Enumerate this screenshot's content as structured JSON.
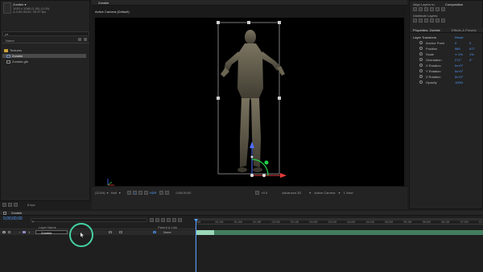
{
  "project": {
    "comp_name": "Zombie ▾",
    "comp_info_1": "1920 x 1080 (1.00) (1.00)",
    "comp_info_2": "Δ 0;00;30;00, 29.97 fps",
    "search_placeholder": "ρ▾",
    "column_name": "Name",
    "items": [
      {
        "label": "Textures",
        "type": "folder"
      },
      {
        "label": "Zombie",
        "type": "comp"
      },
      {
        "label": "Zombie.glb",
        "type": "file"
      }
    ],
    "footer_label": "8 bpc"
  },
  "viewer": {
    "tab_label": "Zombie",
    "camera_label": "Active Camera (Default)",
    "zoom": "(113%)",
    "resolution": "Half",
    "timecode": "0;00;00;00",
    "offset": "+0.0",
    "renderer": "Advanced 3D",
    "camera": "Active Camera",
    "view": "1 View"
  },
  "properties": {
    "align_label": "Align Layers to:",
    "align_value": "Composition",
    "distribute_label": "Distribute Layers:",
    "tab_properties": "Properties: Zombie",
    "tab_effects": "Effects & Presets",
    "section_title": "Layer Transform",
    "reset": "Reset",
    "rows": [
      {
        "name": "Anchor Point",
        "v1": "0",
        "v2": "0"
      },
      {
        "name": "Position",
        "v1": "960",
        "v2": "677"
      },
      {
        "name": "Scale",
        "v1": "∞ 1%",
        "v2": "1%"
      },
      {
        "name": "Orientation",
        "v1": "271°",
        "v2": "0°"
      },
      {
        "name": "X Rotation",
        "v1": "0x+0°",
        "v2": ""
      },
      {
        "name": "Y Rotation",
        "v1": "0x+0°",
        "v2": ""
      },
      {
        "name": "Z Rotation",
        "v1": "0x+0°",
        "v2": ""
      },
      {
        "name": "Opacity",
        "v1": "100%",
        "v2": ""
      }
    ]
  },
  "timeline": {
    "tab_label": "Zombie",
    "timecode": "0;00;00;00",
    "layer_col": "Layer Name",
    "parent_col": "Parent & Link",
    "layer_num": "1",
    "layer_name": "Zombie",
    "parent_value": "None",
    "ruler": [
      "00f",
      "00:15f",
      "01:00f",
      "01:15f",
      "02:00f",
      "02:15f",
      "03:00f",
      "03:15f",
      "04:00f",
      "04:15f",
      "05:00f",
      "05:15f",
      "06:00f",
      "06:15f",
      "07:00f",
      "07:15f"
    ]
  },
  "colors": {
    "accent": "#4f9bff",
    "gizmo_green": "#23d14a",
    "gizmo_red": "#e23a3a",
    "gizmo_blue": "#4f6fff",
    "click_ring": "#43d1a0"
  }
}
